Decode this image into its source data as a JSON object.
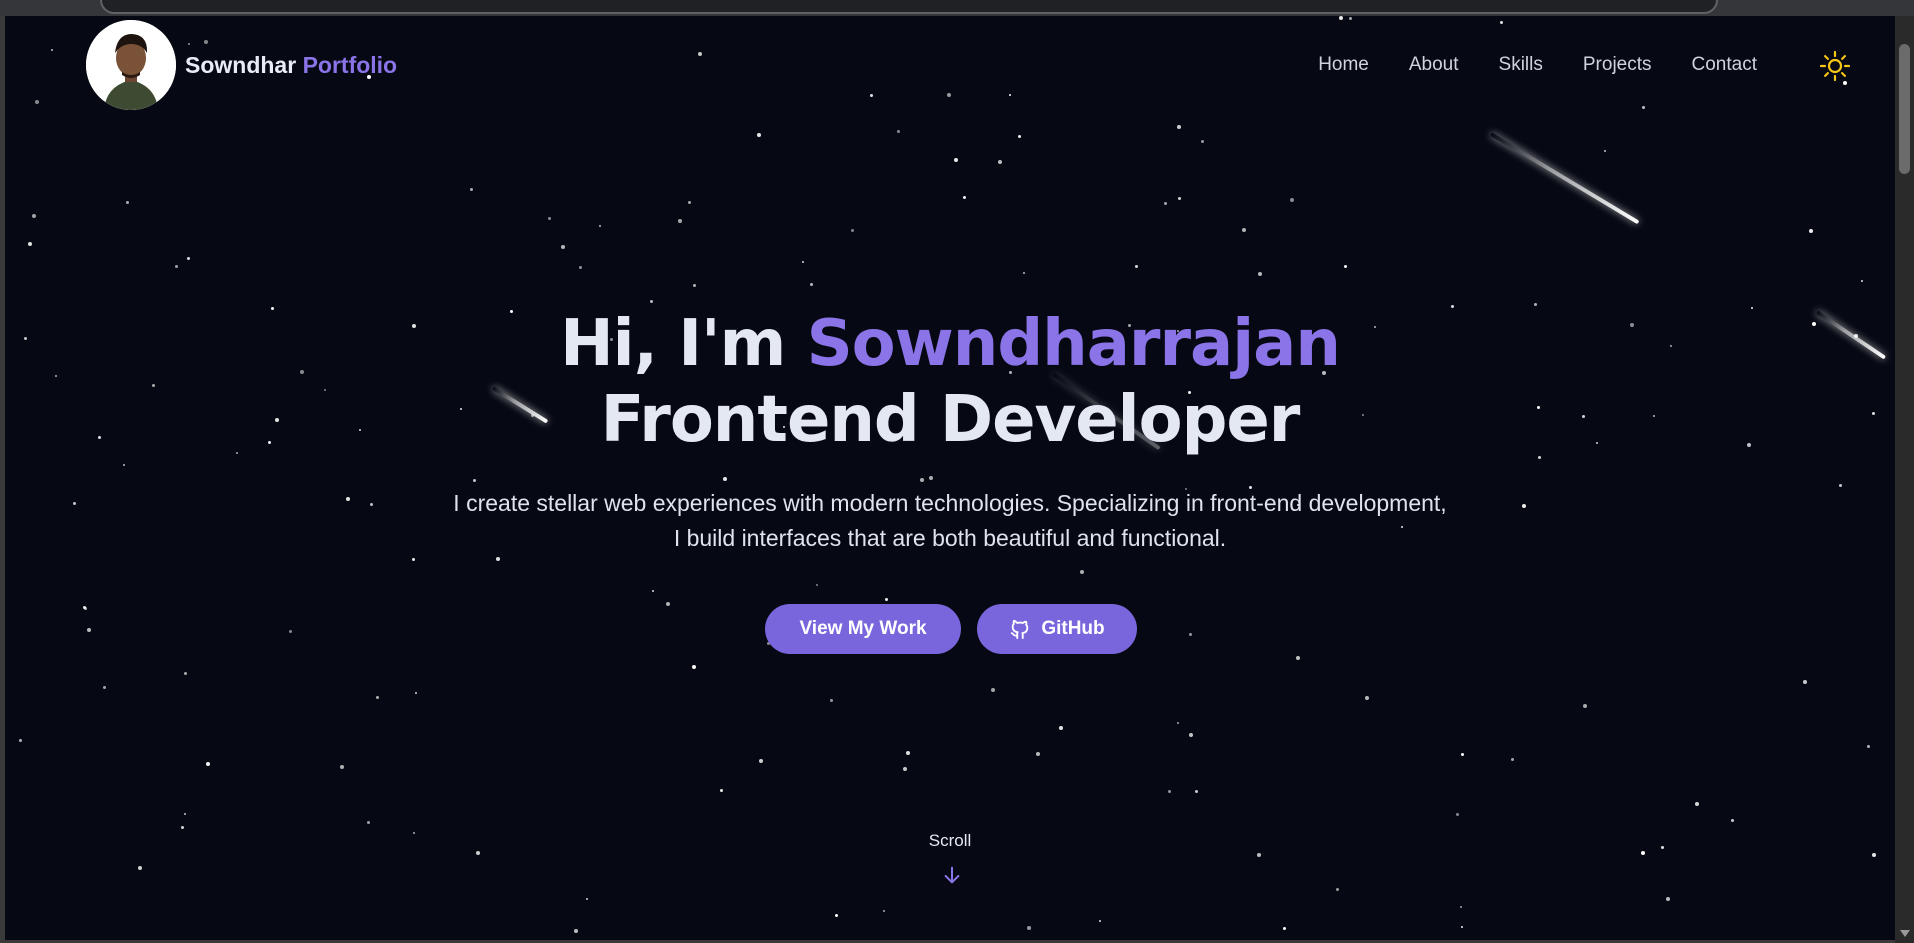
{
  "nav": {
    "brand_name": "Sowndhar",
    "brand_accent": "Portfolio",
    "links": [
      "Home",
      "About",
      "Skills",
      "Projects",
      "Contact"
    ],
    "theme_icon": "sun-icon"
  },
  "hero": {
    "greeting": "Hi, I'm ",
    "name": "Sowndharrajan",
    "role": "Frontend Developer",
    "description": "I create stellar web experiences with modern technologies. Specializing in front-end development, I build interfaces that are both beautiful and functional.",
    "primary_button": "View My Work",
    "secondary_button": "GitHub",
    "secondary_icon": "github-icon",
    "scroll_label": "Scroll",
    "scroll_icon": "arrow-down-icon"
  },
  "colors": {
    "background": "#060913",
    "accent": "#8b74e8",
    "button": "#7a66dc",
    "text": "#e3e8f2",
    "sun": "#f5c518"
  }
}
